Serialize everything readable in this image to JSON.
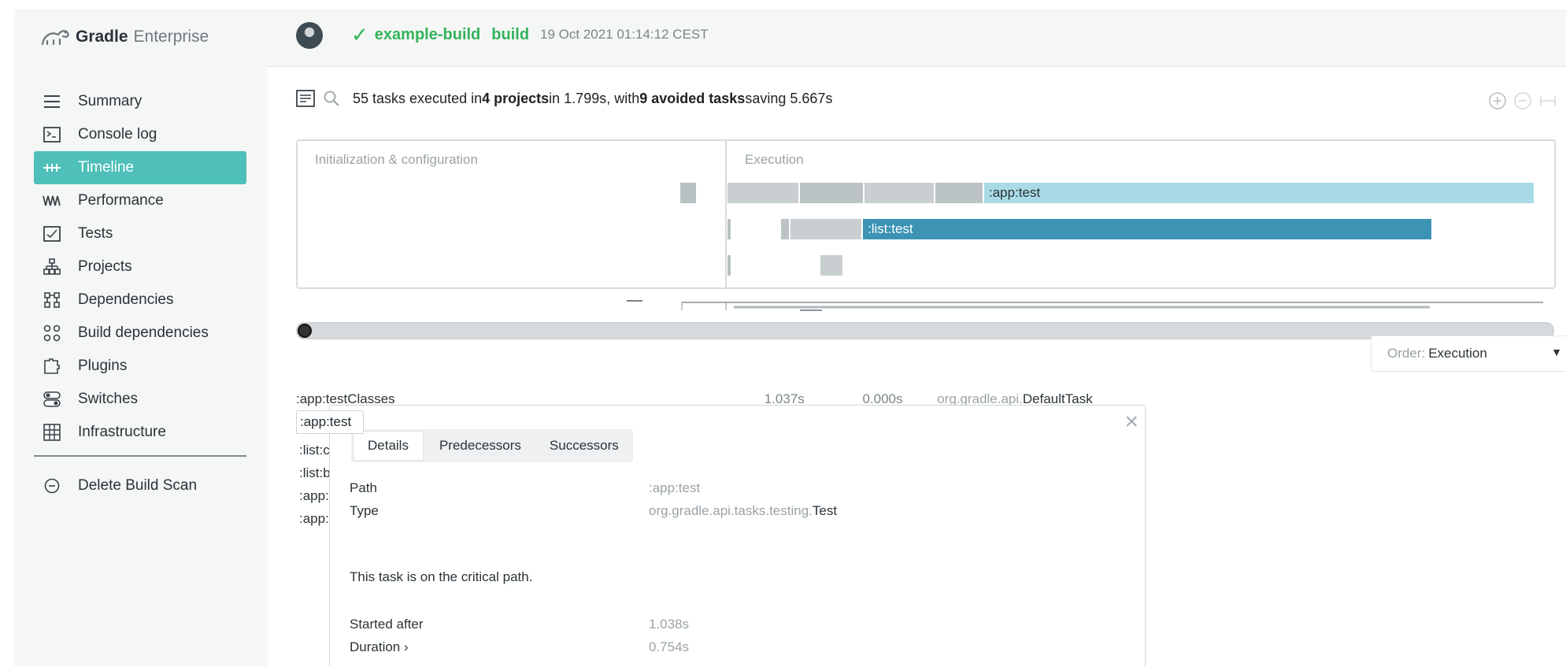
{
  "header": {
    "brand_bold": "Gradle",
    "brand_light": "Enterprise",
    "build_name": "example-build",
    "build_task": "build",
    "build_time": "19 Oct 2021 01:14:12 CEST",
    "help": "?"
  },
  "sidebar": {
    "items": [
      {
        "label": "Summary",
        "icon": "summary-icon"
      },
      {
        "label": "Console log",
        "icon": "console-icon"
      },
      {
        "label": "Timeline",
        "icon": "timeline-icon",
        "active": true
      },
      {
        "label": "Performance",
        "icon": "performance-icon"
      },
      {
        "label": "Tests",
        "icon": "tests-icon"
      },
      {
        "label": "Projects",
        "icon": "projects-icon"
      },
      {
        "label": "Dependencies",
        "icon": "dependencies-icon"
      },
      {
        "label": "Build dependencies",
        "icon": "build-dependencies-icon"
      },
      {
        "label": "Plugins",
        "icon": "plugins-icon"
      },
      {
        "label": "Switches",
        "icon": "switches-icon"
      },
      {
        "label": "Infrastructure",
        "icon": "infrastructure-icon"
      }
    ],
    "delete_label": "Delete Build Scan"
  },
  "summary": {
    "prefix": "55 tasks executed in ",
    "projects": "4 projects",
    "middle": " in 1.799s, with ",
    "avoided": "9 avoided tasks",
    "suffix": " saving 5.667s"
  },
  "timeline": {
    "init_label": "Initialization & configuration",
    "exec_label": "Execution",
    "bars": [
      {
        "label": ":app:test",
        "color": "#a8dbe6"
      },
      {
        "label": ":list:test",
        "color": "#3c93b3"
      }
    ]
  },
  "order": {
    "label": "Order:",
    "value": "Execution"
  },
  "tasks": {
    "row1": {
      "path": ":app:testClasses",
      "duration": "1.037s",
      "saved": "0.000s",
      "type_prefix": "org.gradle.api.",
      "type_name": "DefaultTask"
    },
    "selected": ":app:test",
    "others": [
      ":list:check",
      ":list:build",
      ":app:check",
      ":app:build"
    ]
  },
  "details": {
    "tabs": [
      "Details",
      "Predecessors",
      "Successors"
    ],
    "path_label": "Path",
    "path_value": ":app:test",
    "type_label": "Type",
    "type_prefix": "org.gradle.api.tasks.testing.",
    "type_name": "Test",
    "critical": "This task is on the critical path.",
    "started_label": "Started after",
    "started_value": "1.038s",
    "duration_label": "Duration ›",
    "duration_value": "0.754s"
  },
  "colors": {
    "accent": "#4ebfb9",
    "success": "#33b35a",
    "bar_light": "#a8dbe6",
    "bar_dark": "#3c93b3"
  }
}
